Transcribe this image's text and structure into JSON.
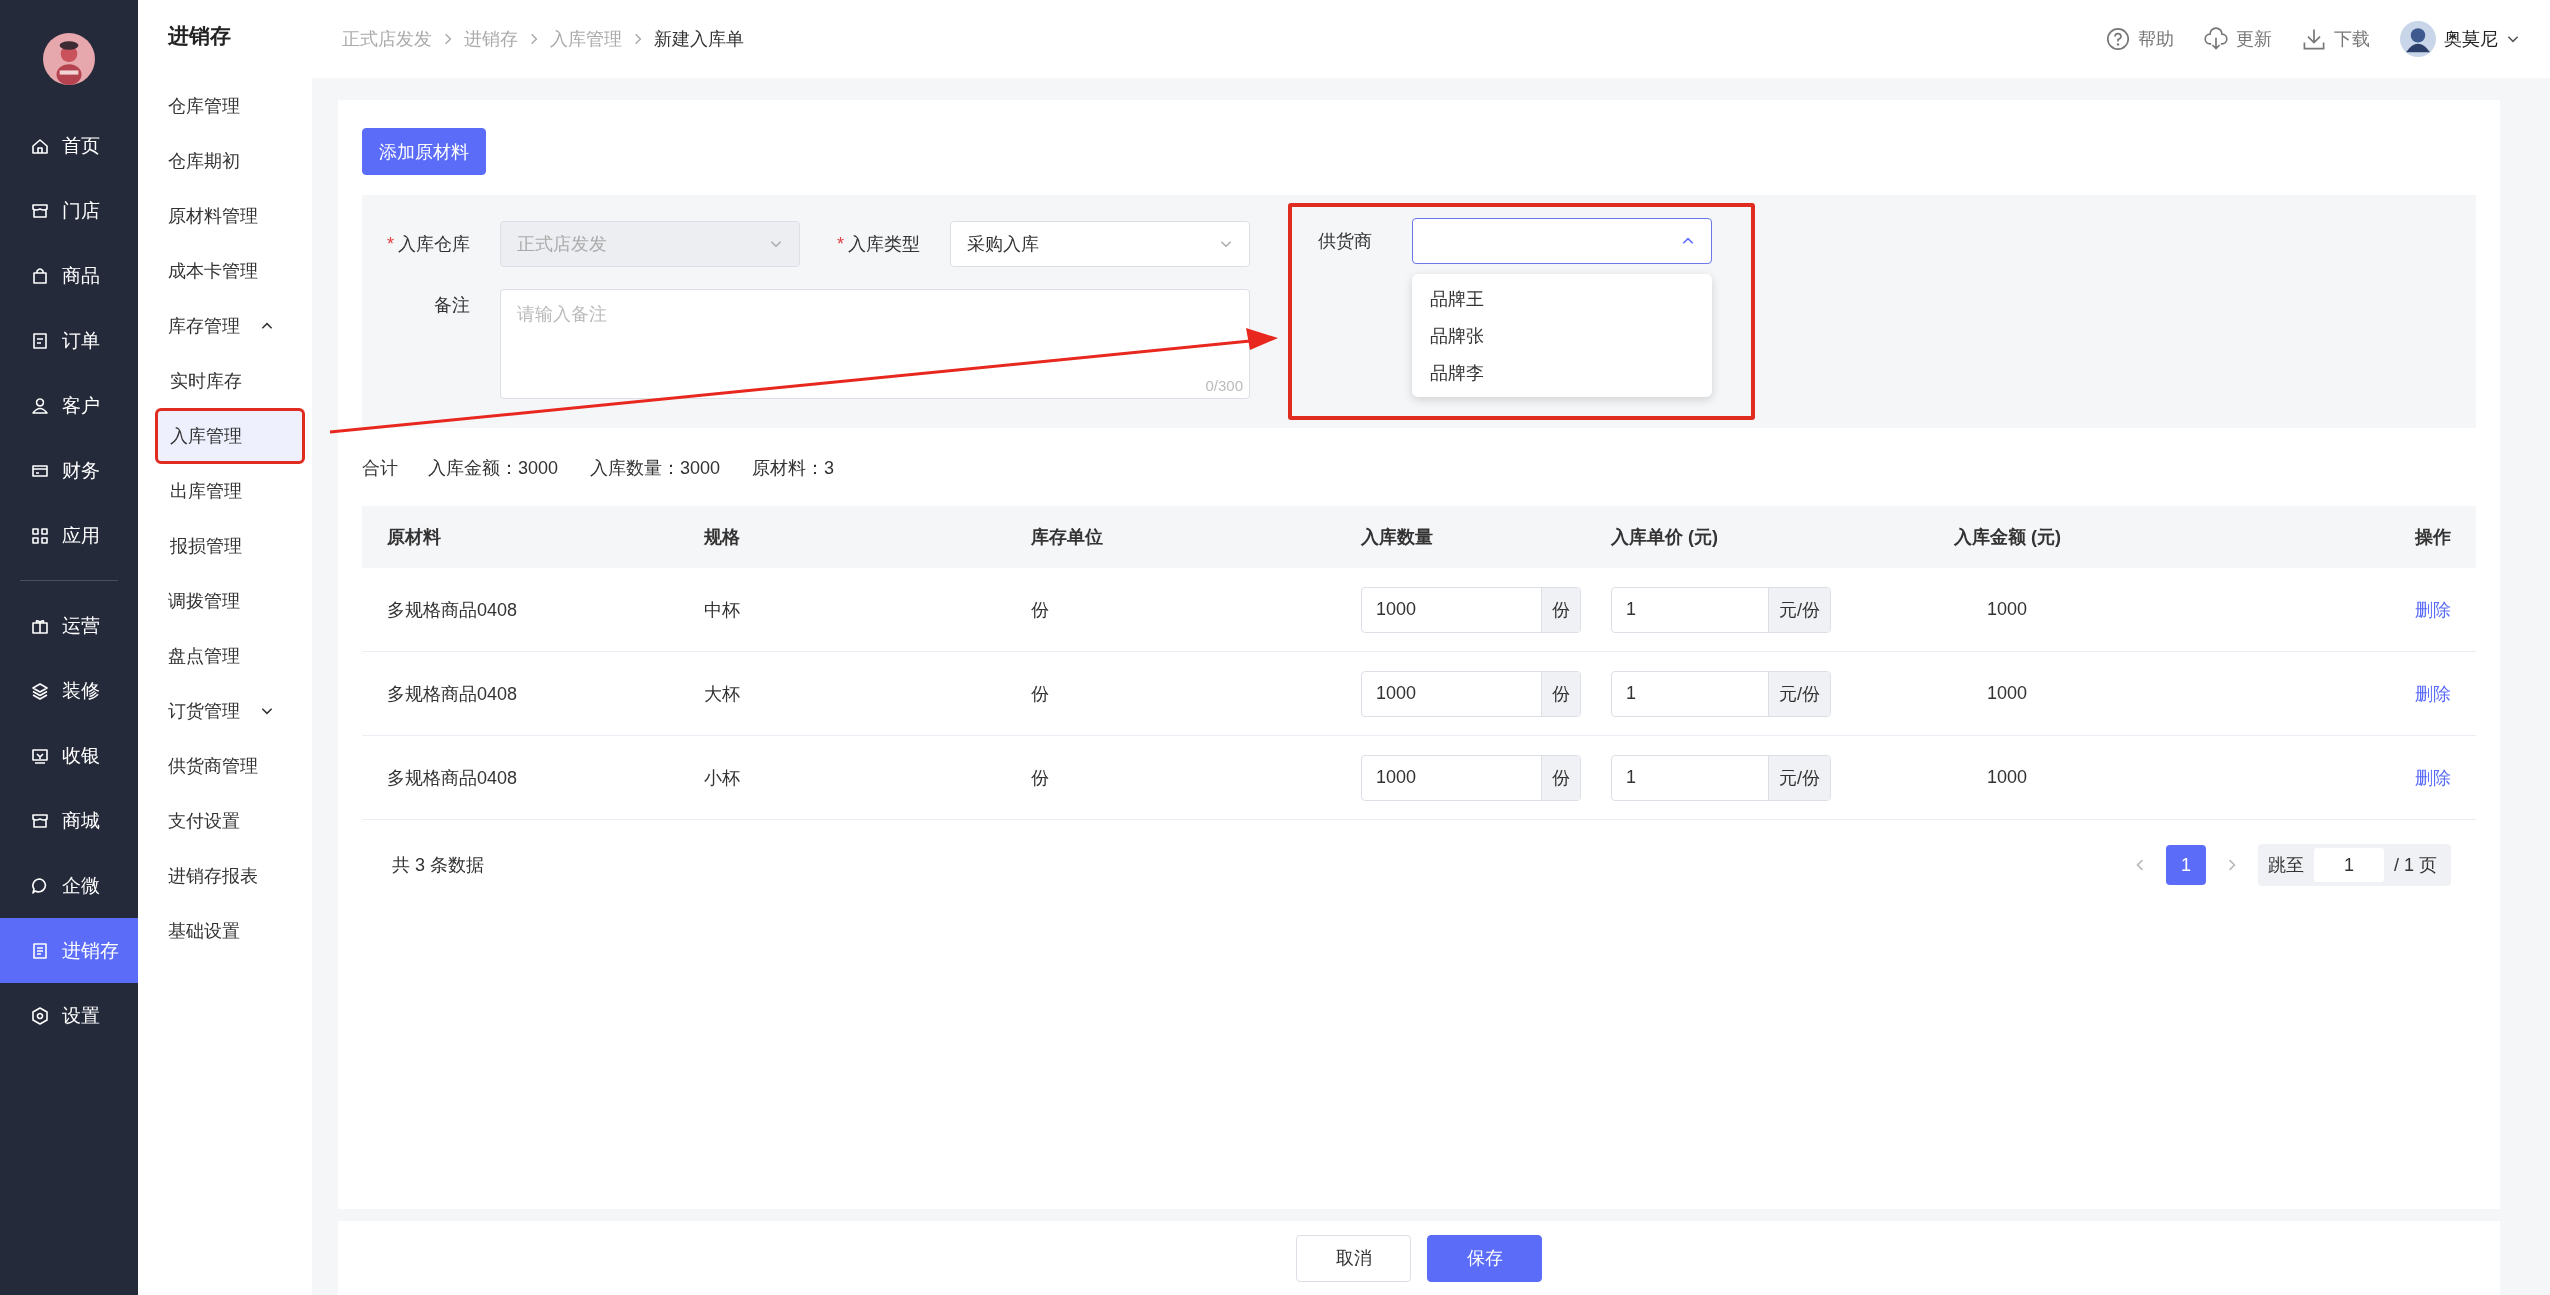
{
  "nav": {
    "primary": [
      {
        "label": "首页",
        "selected": false
      },
      {
        "label": "门店",
        "selected": false
      },
      {
        "label": "商品",
        "selected": false
      },
      {
        "label": "订单",
        "selected": false
      },
      {
        "label": "客户",
        "selected": false
      },
      {
        "label": "财务",
        "selected": false
      },
      {
        "label": "应用",
        "selected": false
      }
    ],
    "secondary": [
      {
        "label": "运营",
        "selected": false
      },
      {
        "label": "装修",
        "selected": false
      },
      {
        "label": "收银",
        "selected": false
      },
      {
        "label": "商城",
        "selected": false
      },
      {
        "label": "企微",
        "selected": false
      },
      {
        "label": "进销存",
        "selected": true
      },
      {
        "label": "设置",
        "selected": false
      }
    ]
  },
  "submenu": {
    "title": "进销存",
    "items": [
      {
        "label": "仓库管理",
        "selected": false
      },
      {
        "label": "仓库期初",
        "selected": false
      },
      {
        "label": "原材料管理",
        "selected": false
      },
      {
        "label": "成本卡管理",
        "selected": false
      },
      {
        "label": "库存管理",
        "selected": false,
        "expanded": true,
        "children": [
          {
            "label": "实时库存",
            "selected": false
          },
          {
            "label": "入库管理",
            "selected": true
          },
          {
            "label": "出库管理",
            "selected": false
          },
          {
            "label": "报损管理",
            "selected": false
          }
        ]
      },
      {
        "label": "调拨管理",
        "selected": false
      },
      {
        "label": "盘点管理",
        "selected": false
      },
      {
        "label": "订货管理",
        "selected": false,
        "expanded": false
      },
      {
        "label": "供货商管理",
        "selected": false
      },
      {
        "label": "支付设置",
        "selected": false
      },
      {
        "label": "进销存报表",
        "selected": false
      },
      {
        "label": "基础设置",
        "selected": false
      }
    ]
  },
  "breadcrumb": [
    "正式店发发",
    "进销存",
    "入库管理",
    "新建入库单"
  ],
  "header": {
    "actions": [
      "帮助",
      "更新",
      "下载"
    ],
    "user": "奥莫尼"
  },
  "form": {
    "add_button": "添加原材料",
    "warehouse": {
      "label": "入库仓库",
      "required_mark": "*",
      "value": "正式店发发",
      "disabled": true
    },
    "type": {
      "label": "入库类型",
      "required_mark": "*",
      "value": "采购入库",
      "disabled": false
    },
    "supplier": {
      "label": "供货商",
      "open": true,
      "options": [
        "品牌王",
        "品牌张",
        "品牌李"
      ]
    },
    "remark": {
      "label": "备注",
      "placeholder": "请输入备注",
      "counter": "0/300"
    }
  },
  "summary": {
    "label": "合计",
    "items": [
      "入库金额：3000",
      "入库数量：3000",
      "原材料：3"
    ]
  },
  "table": {
    "columns": [
      "原材料",
      "规格",
      "库存单位",
      "入库数量",
      "入库单价 (元)",
      "入库金额 (元)",
      "操作"
    ],
    "rows": [
      {
        "material": "多规格商品0408",
        "spec": "中杯",
        "unit": "份",
        "qty": "1000",
        "qty_suffix": "份",
        "price": "1",
        "price_suffix": "元/份",
        "amount": "1000",
        "action": "删除"
      },
      {
        "material": "多规格商品0408",
        "spec": "大杯",
        "unit": "份",
        "qty": "1000",
        "qty_suffix": "份",
        "price": "1",
        "price_suffix": "元/份",
        "amount": "1000",
        "action": "删除"
      },
      {
        "material": "多规格商品0408",
        "spec": "小杯",
        "unit": "份",
        "qty": "1000",
        "qty_suffix": "份",
        "price": "1",
        "price_suffix": "元/份",
        "amount": "1000",
        "action": "删除"
      }
    ]
  },
  "pagination": {
    "total": "共 3 条数据",
    "pages": [
      {
        "label": "1",
        "selected": true
      }
    ],
    "jump_label": "跳至",
    "jump_value": "1",
    "jump_suffix": "/ 1 页"
  },
  "footer": {
    "cancel": "取消",
    "save": "保存"
  }
}
